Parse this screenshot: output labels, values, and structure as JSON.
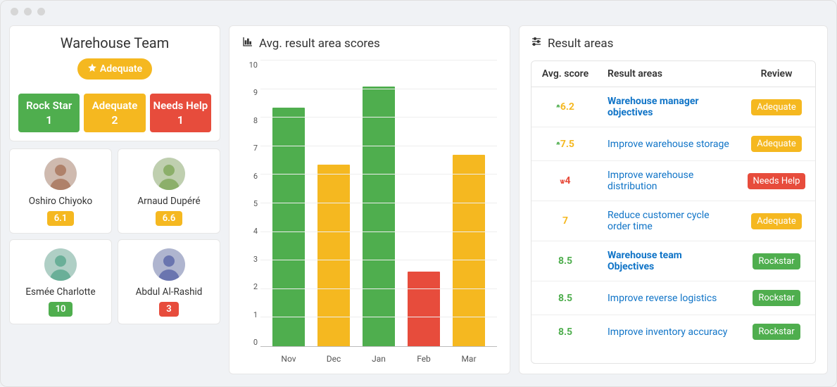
{
  "team": {
    "title": "Warehouse Team",
    "status_label": "Adequate",
    "stats": [
      {
        "label": "Rock Star",
        "count": "1",
        "color": "#4fae4e"
      },
      {
        "label": "Adequate",
        "count": "2",
        "color": "#f5b820"
      },
      {
        "label": "Needs Help",
        "count": "1",
        "color": "#e74c3c"
      }
    ],
    "members": [
      {
        "name": "Oshiro Chiyoko",
        "score": "6.1",
        "badge_color": "#f5b820"
      },
      {
        "name": "Arnaud Dupéré",
        "score": "6.6",
        "badge_color": "#f5b820"
      },
      {
        "name": "Esmée Charlotte",
        "score": "10",
        "badge_color": "#4fae4e"
      },
      {
        "name": "Abdul Al-Rashid",
        "score": "3",
        "badge_color": "#e74c3c"
      }
    ]
  },
  "chart": {
    "title": "Avg. result area scores"
  },
  "chart_data": {
    "type": "bar",
    "categories": [
      "Nov",
      "Dec",
      "Jan",
      "Feb",
      "Mar"
    ],
    "values": [
      8.35,
      6.35,
      9.1,
      2.6,
      6.7
    ],
    "colors": [
      "#4fae4e",
      "#f5b820",
      "#4fae4e",
      "#e74c3c",
      "#f5b820"
    ],
    "ylim": [
      0,
      10
    ],
    "yticks": [
      0,
      1,
      2,
      3,
      4,
      5,
      6,
      7,
      8,
      9,
      10
    ],
    "title": "Avg. result area scores",
    "xlabel": "",
    "ylabel": ""
  },
  "result_areas": {
    "title": "Result areas",
    "headers": {
      "score": "Avg. score",
      "area": "Result areas",
      "review": "Review"
    },
    "rows": [
      {
        "trend": "up",
        "score": "6.2",
        "score_color": "score-orange",
        "title": "Warehouse manager objectives",
        "bold": true,
        "review": "Adequate",
        "review_color": "#f5b820"
      },
      {
        "trend": "up",
        "score": "7.5",
        "score_color": "score-orange",
        "title": "Improve warehouse storage",
        "bold": false,
        "review": "Adequate",
        "review_color": "#f5b820"
      },
      {
        "trend": "down",
        "score": "4",
        "score_color": "score-red",
        "title": "Improve warehouse distribution",
        "bold": false,
        "review": "Needs Help",
        "review_color": "#e74c3c"
      },
      {
        "trend": "",
        "score": "7",
        "score_color": "score-orange",
        "title": "Reduce customer cycle order time",
        "bold": false,
        "review": "Adequate",
        "review_color": "#f5b820"
      },
      {
        "trend": "",
        "score": "8.5",
        "score_color": "score-green",
        "title": "Warehouse team Objectives",
        "bold": true,
        "review": "Rockstar",
        "review_color": "#4fae4e"
      },
      {
        "trend": "",
        "score": "8.5",
        "score_color": "score-green",
        "title": "Improve reverse logistics",
        "bold": false,
        "review": "Rockstar",
        "review_color": "#4fae4e"
      },
      {
        "trend": "",
        "score": "8.5",
        "score_color": "score-green",
        "title": "Improve inventory accuracy",
        "bold": false,
        "review": "Rockstar",
        "review_color": "#4fae4e"
      }
    ]
  }
}
